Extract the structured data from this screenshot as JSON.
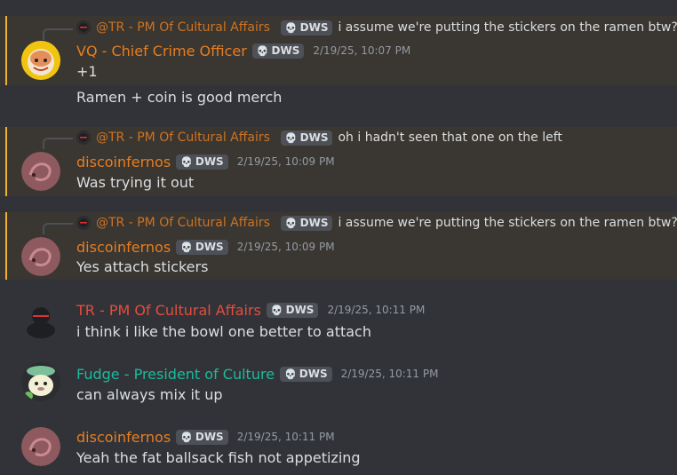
{
  "colors": {
    "highlight_bg": "#3a3631",
    "highlight_bar": "#f0b132",
    "name_orange": "#e67e22",
    "name_red": "#e74c3c",
    "name_teal": "#1abc9c",
    "tag_bg": "#4e5058"
  },
  "messages": [
    {
      "reply": {
        "mention": "@TR - PM Of Cultural Affairs",
        "tag": "DWS",
        "text": "i assume we're putting the stickers on the ramen btw?"
      },
      "author": "VQ - Chief Crime Officer",
      "tag": "DWS",
      "timestamp": "2/19/25, 10:07 PM",
      "avatar_icon": "hamster-avatar-icon",
      "lines": [
        "+1",
        "Ramen + coin is good merch"
      ]
    },
    {
      "reply": {
        "mention": "@TR - PM Of Cultural Affairs",
        "tag": "DWS",
        "text": "oh i hadn't seen that one on the left"
      },
      "author": "discoinfernos",
      "tag": "DWS",
      "timestamp": "2/19/25, 10:09 PM",
      "avatar_icon": "pink-swirl-avatar-icon",
      "lines": [
        "Was trying it out"
      ]
    },
    {
      "reply": {
        "mention": "@TR - PM Of Cultural Affairs",
        "tag": "DWS",
        "text": "i assume we're putting the stickers on the ramen btw?"
      },
      "author": "discoinfernos",
      "tag": "DWS",
      "timestamp": "2/19/25, 10:09 PM",
      "avatar_icon": "pink-swirl-avatar-icon",
      "lines": [
        "Yes attach stickers"
      ]
    },
    {
      "author": "TR - PM Of Cultural Affairs",
      "tag": "DWS",
      "timestamp": "2/19/25, 10:11 PM",
      "avatar_icon": "black-blob-avatar-icon",
      "lines": [
        "i think i like the bowl one better to attach"
      ]
    },
    {
      "author": "Fudge - President of Culture",
      "tag": "DWS",
      "timestamp": "2/19/25, 10:11 PM",
      "avatar_icon": "dog-avatar-icon",
      "lines": [
        "can always mix it up"
      ]
    },
    {
      "author": "discoinfernos",
      "tag": "DWS",
      "timestamp": "2/19/25, 10:11 PM",
      "avatar_icon": "pink-swirl-avatar-icon",
      "lines": [
        "Yeah the fat ballsack fish not appetizing"
      ]
    }
  ]
}
